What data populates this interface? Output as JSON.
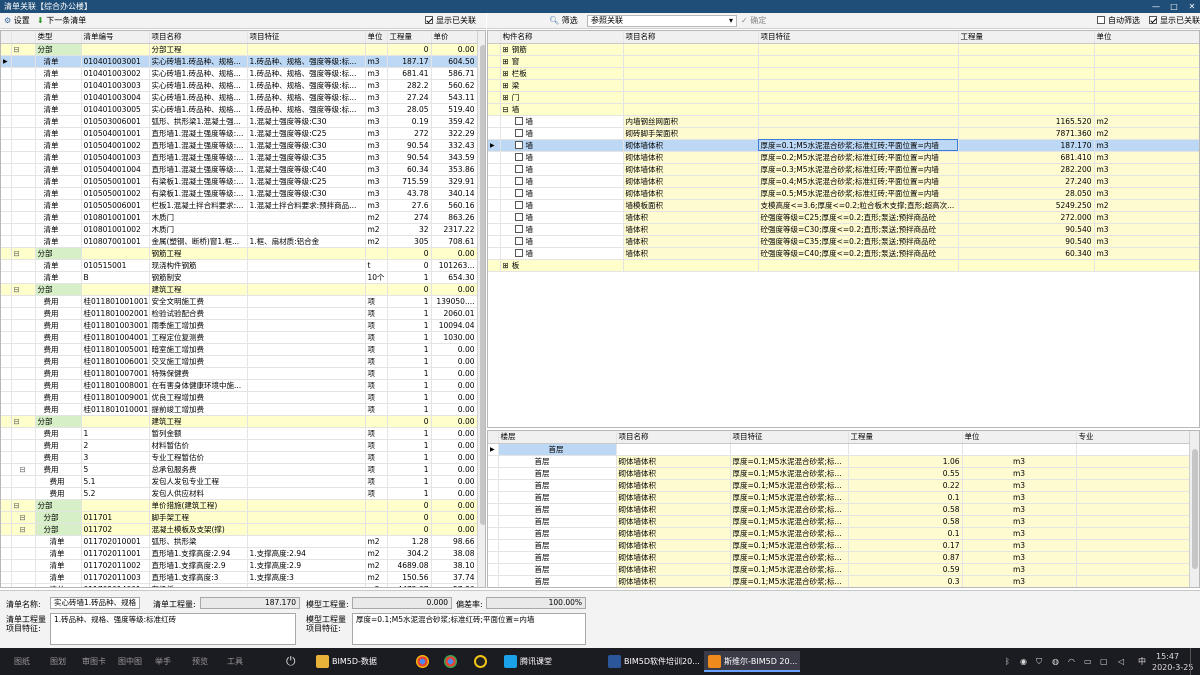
{
  "window": {
    "title": "清单关联【综合办公楼】",
    "minimize": "—",
    "maximize": "□",
    "close": "✕"
  },
  "left_toolbar": {
    "settings": "设置",
    "next": "下一条清单",
    "show_linked": "显示已关联"
  },
  "right_toolbar": {
    "filter": "筛选",
    "ref_label": "参照关联",
    "confirm": "确定",
    "auto_filter": "自动筛选",
    "show_linked": "显示已关联"
  },
  "left_table": {
    "headers": [
      "类型",
      "清单编号",
      "项目名称",
      "项目特征",
      "单位",
      "工程量",
      "单价"
    ],
    "rows": [
      {
        "lvl": 0,
        "grp": 1,
        "exp": "⊟",
        "type": "分部",
        "code": "",
        "name": "分部工程",
        "feat": "",
        "unit": "",
        "qty": "0",
        "price": "0.00"
      },
      {
        "lvl": 1,
        "sel": 1,
        "type": "清单",
        "code": "010401003001",
        "name": "实心砖墙1.砖品种、规格...",
        "feat": "1.砖品种、规格、强度等级:标...",
        "unit": "m3",
        "qty": "187.17",
        "price": "604.50"
      },
      {
        "lvl": 1,
        "type": "清单",
        "code": "010401003002",
        "name": "实心砖墙1.砖品种、规格...",
        "feat": "1.砖品种、规格、强度等级:标...",
        "unit": "m3",
        "qty": "681.41",
        "price": "586.71"
      },
      {
        "lvl": 1,
        "type": "清单",
        "code": "010401003003",
        "name": "实心砖墙1.砖品种、规格...",
        "feat": "1.砖品种、规格、强度等级:标...",
        "unit": "m3",
        "qty": "282.2",
        "price": "560.62"
      },
      {
        "lvl": 1,
        "type": "清单",
        "code": "010401003004",
        "name": "实心砖墙1.砖品种、规格...",
        "feat": "1.砖品种、规格、强度等级:标...",
        "unit": "m3",
        "qty": "27.24",
        "price": "543.11"
      },
      {
        "lvl": 1,
        "type": "清单",
        "code": "010401003005",
        "name": "实心砖墙1.砖品种、规格...",
        "feat": "1.砖品种、规格、强度等级:标...",
        "unit": "m3",
        "qty": "28.05",
        "price": "519.40"
      },
      {
        "lvl": 1,
        "type": "清单",
        "code": "010503006001",
        "name": "弧形、拱形梁1.混凝土强...",
        "feat": "1.混凝土强度等级:C30",
        "unit": "m3",
        "qty": "0.19",
        "price": "359.42"
      },
      {
        "lvl": 1,
        "type": "清单",
        "code": "010504001001",
        "name": "直形墙1.混凝土强度等级:...",
        "feat": "1.混凝土强度等级:C25",
        "unit": "m3",
        "qty": "272",
        "price": "322.29"
      },
      {
        "lvl": 1,
        "type": "清单",
        "code": "010504001002",
        "name": "直形墙1.混凝土强度等级:...",
        "feat": "1.混凝土强度等级:C30",
        "unit": "m3",
        "qty": "90.54",
        "price": "332.43"
      },
      {
        "lvl": 1,
        "type": "清单",
        "code": "010504001003",
        "name": "直形墙1.混凝土强度等级:...",
        "feat": "1.混凝土强度等级:C35",
        "unit": "m3",
        "qty": "90.54",
        "price": "343.59"
      },
      {
        "lvl": 1,
        "type": "清单",
        "code": "010504001004",
        "name": "直形墙1.混凝土强度等级:...",
        "feat": "1.混凝土强度等级:C40",
        "unit": "m3",
        "qty": "60.34",
        "price": "353.86"
      },
      {
        "lvl": 1,
        "type": "清单",
        "code": "010505001001",
        "name": "有梁板1.混凝土强度等级:...",
        "feat": "1.混凝土强度等级:C25",
        "unit": "m3",
        "qty": "715.59",
        "price": "329.91"
      },
      {
        "lvl": 1,
        "type": "清单",
        "code": "010505001002",
        "name": "有梁板1.混凝土强度等级:...",
        "feat": "1.混凝土强度等级:C30",
        "unit": "m3",
        "qty": "43.78",
        "price": "340.14"
      },
      {
        "lvl": 1,
        "type": "清单",
        "code": "010505006001",
        "name": "栏板1.混凝土拌合料要求:...",
        "feat": "1.混凝土拌合料要求:预拌商品...",
        "unit": "m3",
        "qty": "27.6",
        "price": "560.16"
      },
      {
        "lvl": 1,
        "type": "清单",
        "code": "010801001001",
        "name": "木质门",
        "feat": "",
        "unit": "m2",
        "qty": "274",
        "price": "863.26"
      },
      {
        "lvl": 1,
        "type": "清单",
        "code": "010801001002",
        "name": "木质门",
        "feat": "",
        "unit": "m2",
        "qty": "32",
        "price": "2317.22"
      },
      {
        "lvl": 1,
        "type": "清单",
        "code": "010807001001",
        "name": "金属(塑钢、断桥)窗1.框...",
        "feat": "1.框、扇材质:铝合金",
        "unit": "m2",
        "qty": "305",
        "price": "708.61"
      },
      {
        "lvl": 0,
        "grp": 1,
        "exp": "⊟",
        "type": "分部",
        "code": "",
        "name": "钢筋工程",
        "feat": "",
        "unit": "",
        "qty": "0",
        "price": "0.00"
      },
      {
        "lvl": 1,
        "type": "清单",
        "code": "010515001",
        "name": "现浇构件钢筋",
        "feat": "",
        "unit": "t",
        "qty": "0",
        "price": "101263..."
      },
      {
        "lvl": 1,
        "type": "清单",
        "code": "B",
        "name": "钢筋制安",
        "feat": "",
        "unit": "10个",
        "qty": "1",
        "price": "654.30"
      },
      {
        "lvl": 0,
        "grp": 1,
        "exp": "⊟",
        "type": "分部",
        "code": "",
        "name": "建筑工程",
        "feat": "",
        "unit": "",
        "qty": "0",
        "price": "0.00"
      },
      {
        "lvl": 1,
        "type": "费用",
        "code": "桂011801001001",
        "name": "安全文明施工费",
        "feat": "",
        "unit": "项",
        "qty": "1",
        "price": "139050...."
      },
      {
        "lvl": 1,
        "type": "费用",
        "code": "桂011801002001",
        "name": "检验试验配合费",
        "feat": "",
        "unit": "项",
        "qty": "1",
        "price": "2060.01"
      },
      {
        "lvl": 1,
        "type": "费用",
        "code": "桂011801003001",
        "name": "雨季施工增加费",
        "feat": "",
        "unit": "项",
        "qty": "1",
        "price": "10094.04"
      },
      {
        "lvl": 1,
        "type": "费用",
        "code": "桂011801004001",
        "name": "工程定位复测费",
        "feat": "",
        "unit": "项",
        "qty": "1",
        "price": "1030.00"
      },
      {
        "lvl": 1,
        "type": "费用",
        "code": "桂011801005001",
        "name": "暗室施工增加费",
        "feat": "",
        "unit": "项",
        "qty": "1",
        "price": "0.00"
      },
      {
        "lvl": 1,
        "type": "费用",
        "code": "桂011801006001",
        "name": "交叉施工增加费",
        "feat": "",
        "unit": "项",
        "qty": "1",
        "price": "0.00"
      },
      {
        "lvl": 1,
        "type": "费用",
        "code": "桂011801007001",
        "name": "特殊保健费",
        "feat": "",
        "unit": "项",
        "qty": "1",
        "price": "0.00"
      },
      {
        "lvl": 1,
        "type": "费用",
        "code": "桂011801008001",
        "name": "在有害身体健康环境中施...",
        "feat": "",
        "unit": "项",
        "qty": "1",
        "price": "0.00"
      },
      {
        "lvl": 1,
        "type": "费用",
        "code": "桂011801009001",
        "name": "优良工程增加费",
        "feat": "",
        "unit": "项",
        "qty": "1",
        "price": "0.00"
      },
      {
        "lvl": 1,
        "type": "费用",
        "code": "桂011801010001",
        "name": "提前竣工增加费",
        "feat": "",
        "unit": "项",
        "qty": "1",
        "price": "0.00"
      },
      {
        "lvl": 0,
        "grp": 1,
        "exp": "⊟",
        "type": "分部",
        "code": "",
        "name": "建筑工程",
        "feat": "",
        "unit": "",
        "qty": "0",
        "price": "0.00"
      },
      {
        "lvl": 1,
        "type": "费用",
        "code": "1",
        "name": "暂列金额",
        "feat": "",
        "unit": "项",
        "qty": "1",
        "price": "0.00"
      },
      {
        "lvl": 1,
        "type": "费用",
        "code": "2",
        "name": "材料暂估价",
        "feat": "",
        "unit": "项",
        "qty": "1",
        "price": "0.00"
      },
      {
        "lvl": 1,
        "type": "费用",
        "code": "3",
        "name": "专业工程暂估价",
        "feat": "",
        "unit": "项",
        "qty": "1",
        "price": "0.00"
      },
      {
        "lvl": 1,
        "exp": "⊟",
        "type": "费用",
        "code": "5",
        "name": "总承包服务费",
        "feat": "",
        "unit": "项",
        "qty": "1",
        "price": "0.00"
      },
      {
        "lvl": 2,
        "type": "费用",
        "code": "5.1",
        "name": "发包人发包专业工程",
        "feat": "",
        "unit": "项",
        "qty": "1",
        "price": "0.00"
      },
      {
        "lvl": 2,
        "type": "费用",
        "code": "5.2",
        "name": "发包人供应材料",
        "feat": "",
        "unit": "项",
        "qty": "1",
        "price": "0.00"
      },
      {
        "lvl": 0,
        "grp": 1,
        "exp": "⊟",
        "type": "分部",
        "code": "",
        "name": "单价措施(建筑工程)",
        "feat": "",
        "unit": "",
        "qty": "0",
        "price": "0.00"
      },
      {
        "lvl": 1,
        "grp": 1,
        "exp": "⊟",
        "type": "分部",
        "code": "011701",
        "name": "脚手架工程",
        "feat": "",
        "unit": "",
        "qty": "0",
        "price": "0.00"
      },
      {
        "lvl": 1,
        "grp": 1,
        "exp": "⊟",
        "type": "分部",
        "code": "011702",
        "name": "混凝土模板及支架(撑)",
        "feat": "",
        "unit": "",
        "qty": "0",
        "price": "0.00"
      },
      {
        "lvl": 2,
        "type": "清单",
        "code": "011702010001",
        "name": "弧形、拱形梁",
        "feat": "",
        "unit": "m2",
        "qty": "1.28",
        "price": "98.66"
      },
      {
        "lvl": 2,
        "type": "清单",
        "code": "011702011001",
        "name": "直形墙1.支撑高度:2.94",
        "feat": "1.支撑高度:2.94",
        "unit": "m2",
        "qty": "304.2",
        "price": "38.08"
      },
      {
        "lvl": 2,
        "type": "清单",
        "code": "011702011002",
        "name": "直形墙1.支撑高度:2.9",
        "feat": "1.支撑高度:2.9",
        "unit": "m2",
        "qty": "4689.08",
        "price": "38.10"
      },
      {
        "lvl": 2,
        "type": "清单",
        "code": "011702011003",
        "name": "直形墙1.支撑高度:3",
        "feat": "1.支撑高度:3",
        "unit": "m2",
        "qty": "150.56",
        "price": "37.74"
      },
      {
        "lvl": 2,
        "type": "清单",
        "code": "011702014001",
        "name": "有梁板...",
        "feat": "",
        "unit": "m2",
        "qty": "4472.07",
        "price": "57.86"
      }
    ]
  },
  "comp_table": {
    "headers": [
      "构件名称",
      "项目名称",
      "项目特征",
      "工程量",
      "单位"
    ],
    "rows": [
      {
        "tree": "⊞",
        "cb": 0,
        "name": "钢筋",
        "proj": "",
        "feat": "",
        "qty": "",
        "unit": ""
      },
      {
        "tree": "⊞",
        "cb": 0,
        "name": "窗",
        "proj": "",
        "feat": "",
        "qty": "",
        "unit": ""
      },
      {
        "tree": "⊞",
        "cb": 0,
        "name": "栏板",
        "proj": "",
        "feat": "",
        "qty": "",
        "unit": ""
      },
      {
        "tree": "⊞",
        "cb": 0,
        "name": "梁",
        "proj": "",
        "feat": "",
        "qty": "",
        "unit": ""
      },
      {
        "tree": "⊞",
        "cb": 0,
        "name": "门",
        "proj": "",
        "feat": "",
        "qty": "",
        "unit": ""
      },
      {
        "tree": "⊟",
        "cb": 0,
        "name": "墙",
        "proj": "",
        "feat": "",
        "qty": "",
        "unit": ""
      },
      {
        "child": 1,
        "cb": 1,
        "name": "墙",
        "proj": "内墙钢丝网面积",
        "feat": "",
        "qty": "1165.520",
        "unit": "m2"
      },
      {
        "child": 1,
        "cb": 1,
        "name": "墙",
        "proj": "砌砖脚手架面积",
        "feat": "",
        "qty": "7871.360",
        "unit": "m2"
      },
      {
        "child": 1,
        "cb": 1,
        "sel": 1,
        "name": "墙",
        "proj": "砌体墙体积",
        "feat": "厚度=0.1;M5水泥混合砂浆;标准红砖;平面位置=内墙",
        "qty": "187.170",
        "unit": "m3"
      },
      {
        "child": 1,
        "cb": 1,
        "name": "墙",
        "proj": "砌体墙体积",
        "feat": "厚度=0.2;M5水泥混合砂浆;标准红砖;平面位置=内墙",
        "qty": "681.410",
        "unit": "m3"
      },
      {
        "child": 1,
        "cb": 1,
        "name": "墙",
        "proj": "砌体墙体积",
        "feat": "厚度=0.3;M5水泥混合砂浆;标准红砖;平面位置=内墙",
        "qty": "282.200",
        "unit": "m3"
      },
      {
        "child": 1,
        "cb": 1,
        "name": "墙",
        "proj": "砌体墙体积",
        "feat": "厚度=0.4;M5水泥混合砂浆;标准红砖;平面位置=内墙",
        "qty": "27.240",
        "unit": "m3"
      },
      {
        "child": 1,
        "cb": 1,
        "name": "墙",
        "proj": "砌体墙体积",
        "feat": "厚度=0.5;M5水泥混合砂浆;标准红砖;平面位置=内墙",
        "qty": "28.050",
        "unit": "m3"
      },
      {
        "child": 1,
        "cb": 1,
        "name": "墙",
        "proj": "墙模板面积",
        "feat": "支模高度<=3.6;厚度<=0.2;粒合板木支撑;直形;超高次...",
        "qty": "5249.250",
        "unit": "m2"
      },
      {
        "child": 1,
        "cb": 1,
        "name": "墙",
        "proj": "墙体积",
        "feat": "砼强度等级=C25;厚度<=0.2;直形;泵送;预拌商品砼",
        "qty": "272.000",
        "unit": "m3"
      },
      {
        "child": 1,
        "cb": 1,
        "name": "墙",
        "proj": "墙体积",
        "feat": "砼强度等级=C30;厚度<=0.2;直形;泵送;预拌商品砼",
        "qty": "90.540",
        "unit": "m3"
      },
      {
        "child": 1,
        "cb": 1,
        "name": "墙",
        "proj": "墙体积",
        "feat": "砼强度等级=C35;厚度<=0.2;直形;泵送;预拌商品砼",
        "qty": "90.540",
        "unit": "m3"
      },
      {
        "child": 1,
        "cb": 1,
        "name": "墙",
        "proj": "墙体积",
        "feat": "砼强度等级=C40;厚度<=0.2;直形;泵送;预拌商品砼",
        "qty": "60.340",
        "unit": "m3"
      },
      {
        "tree": "⊞",
        "cb": 0,
        "name": "板",
        "proj": "",
        "feat": "",
        "qty": "",
        "unit": ""
      }
    ]
  },
  "floor_table": {
    "headers": [
      "楼层",
      "项目名称",
      "项目特征",
      "工程量",
      "单位",
      "专业"
    ],
    "rows": [
      {
        "grp": 1,
        "floor": "首层",
        "proj": "",
        "feat": "",
        "qty": "",
        "unit": "",
        "spec": ""
      },
      {
        "floor": "首层",
        "proj": "砌体墙体积",
        "feat": "厚度=0.1;M5水泥混合砂浆;标...",
        "qty": "1.06",
        "unit": "m3",
        "spec": ""
      },
      {
        "floor": "首层",
        "proj": "砌体墙体积",
        "feat": "厚度=0.1;M5水泥混合砂浆;标...",
        "qty": "0.55",
        "unit": "m3",
        "spec": ""
      },
      {
        "floor": "首层",
        "proj": "砌体墙体积",
        "feat": "厚度=0.1;M5水泥混合砂浆;标...",
        "qty": "0.22",
        "unit": "m3",
        "spec": ""
      },
      {
        "floor": "首层",
        "proj": "砌体墙体积",
        "feat": "厚度=0.1;M5水泥混合砂浆;标...",
        "qty": "0.1",
        "unit": "m3",
        "spec": ""
      },
      {
        "floor": "首层",
        "proj": "砌体墙体积",
        "feat": "厚度=0.1;M5水泥混合砂浆;标...",
        "qty": "0.58",
        "unit": "m3",
        "spec": ""
      },
      {
        "floor": "首层",
        "proj": "砌体墙体积",
        "feat": "厚度=0.1;M5水泥混合砂浆;标...",
        "qty": "0.58",
        "unit": "m3",
        "spec": ""
      },
      {
        "floor": "首层",
        "proj": "砌体墙体积",
        "feat": "厚度=0.1;M5水泥混合砂浆;标...",
        "qty": "0.1",
        "unit": "m3",
        "spec": ""
      },
      {
        "floor": "首层",
        "proj": "砌体墙体积",
        "feat": "厚度=0.1;M5水泥混合砂浆;标...",
        "qty": "0.17",
        "unit": "m3",
        "spec": ""
      },
      {
        "floor": "首层",
        "proj": "砌体墙体积",
        "feat": "厚度=0.1;M5水泥混合砂浆;标...",
        "qty": "0.87",
        "unit": "m3",
        "spec": ""
      },
      {
        "floor": "首层",
        "proj": "砌体墙体积",
        "feat": "厚度=0.1;M5水泥混合砂浆;标...",
        "qty": "0.59",
        "unit": "m3",
        "spec": ""
      },
      {
        "floor": "首层",
        "proj": "砌体墙体积",
        "feat": "厚度=0.1;M5水泥混合砂浆;标...",
        "qty": "0.3",
        "unit": "m3",
        "spec": ""
      }
    ]
  },
  "bottom": {
    "bill_name_label": "清单名称:",
    "bill_name": "实心砖墙1.砖品种、规格",
    "bill_qty_label": "清单工程量:",
    "bill_qty": "187.170",
    "model_qty_label": "模型工程量:",
    "model_qty": "0.000",
    "deviation_label": "偏差率:",
    "deviation": "100.00%",
    "bill_feat_label1": "清单工程量",
    "bill_feat_label2": "项目特征:",
    "bill_feat": "1.砖品种、规格、强度等级:标准红砖",
    "model_feat_label1": "模型工程量",
    "model_feat_label2": "项目特征:",
    "model_feat": "厚度=0.1;M5水泥混合砂浆;标准红砖;平面位置=内墙"
  },
  "taskbar": {
    "tabs": [
      "图纸",
      "图划",
      "审图卡",
      "图中图",
      "举手",
      "预览",
      "工具"
    ],
    "apps": [
      "BIM5D-数据",
      "腾讯课堂",
      "BIM5D软件培训20...",
      "斯维尔-BIM5D 20..."
    ],
    "ime": "中",
    "time": "15:47",
    "date": "2020-3-25"
  }
}
